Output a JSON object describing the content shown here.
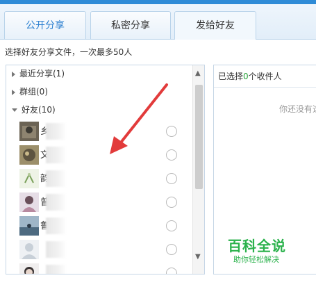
{
  "tabs": [
    {
      "label": "公开分享"
    },
    {
      "label": "私密分享"
    },
    {
      "label": "发给好友"
    }
  ],
  "hint": "选择好友分享文件，一次最多50人",
  "groups": {
    "recent": "最近分享(1)",
    "groupchat": "群组(0)",
    "friends": "好友(10)"
  },
  "friends": [
    {
      "name": "乡"
    },
    {
      "name": "文"
    },
    {
      "name": "韵"
    },
    {
      "name": "曾"
    },
    {
      "name": "鲁"
    },
    {
      "name": ""
    },
    {
      "name": ""
    }
  ],
  "selected": {
    "prefix": "已选择",
    "count": "0",
    "suffix": "个收件人",
    "empty": "你还没有选"
  },
  "watermark": {
    "title": "百科全说",
    "subtitle": "助你轻松解决"
  },
  "colors": {
    "accent": "#2f8bd7",
    "count_green": "#2aa43c",
    "arrow_red": "#e23b3b",
    "watermark_green": "#2bb24c"
  }
}
